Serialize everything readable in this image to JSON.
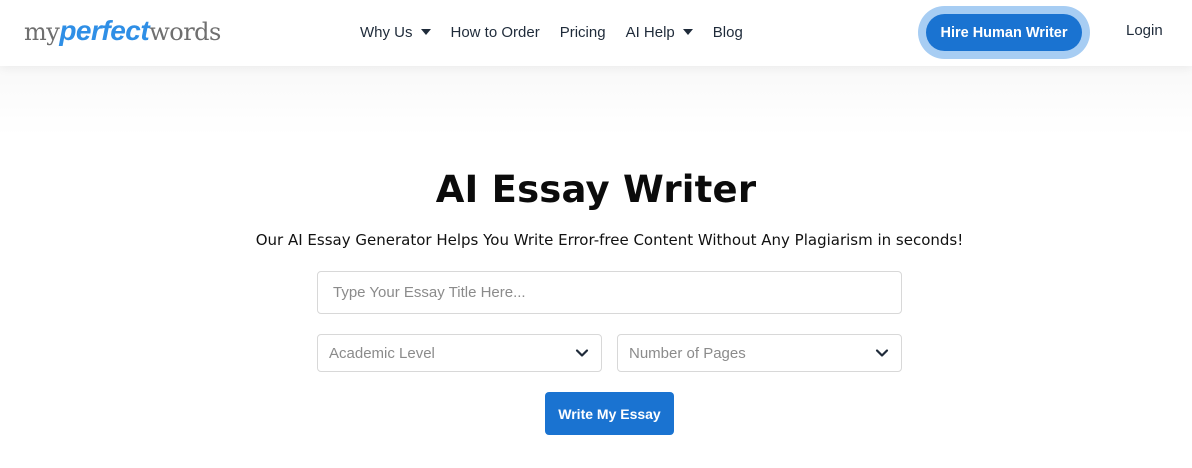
{
  "header": {
    "logo": {
      "part1": "my",
      "part2": "perfect",
      "part3": "words"
    },
    "nav": [
      {
        "label": "Why Us",
        "has_dropdown": true
      },
      {
        "label": "How to Order",
        "has_dropdown": false
      },
      {
        "label": "Pricing",
        "has_dropdown": false
      },
      {
        "label": "AI Help",
        "has_dropdown": true
      },
      {
        "label": "Blog",
        "has_dropdown": false
      }
    ],
    "cta_label": "Hire Human Writer",
    "login_label": "Login"
  },
  "main": {
    "title": "AI Essay Writer",
    "subtitle": "Our AI Essay Generator Helps You Write Error-free Content Without Any Plagiarism in seconds!",
    "essay_title_placeholder": "Type Your Essay Title Here...",
    "academic_level_label": "Academic Level",
    "pages_label": "Number of Pages",
    "submit_label": "Write My Essay"
  },
  "colors": {
    "accent": "#1a73d1",
    "accent_ring": "#a7cdf3",
    "logo_blue": "#2f8fe6",
    "logo_gray": "#6f6f6f"
  }
}
